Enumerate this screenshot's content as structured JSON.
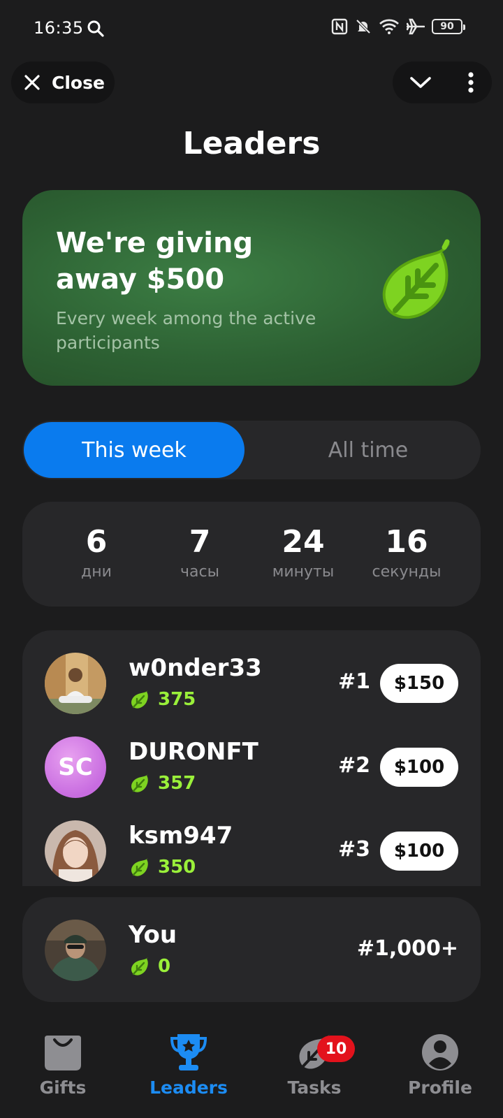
{
  "status_bar": {
    "time": "16:35",
    "battery": "90"
  },
  "topbar": {
    "close_label": "Close"
  },
  "page": {
    "title": "Leaders"
  },
  "banner": {
    "headline": "We're giving away $500",
    "subtitle": "Every week among the active participants"
  },
  "segmented": {
    "options": [
      "This week",
      "All time"
    ],
    "selected": "This week"
  },
  "countdown": [
    {
      "value": "6",
      "unit": "дни"
    },
    {
      "value": "7",
      "unit": "часы"
    },
    {
      "value": "24",
      "unit": "минуты"
    },
    {
      "value": "16",
      "unit": "секунды"
    }
  ],
  "leaderboard": [
    {
      "name": "w0nder33",
      "score": "375",
      "rank": "#1",
      "prize": "$150",
      "avatar": "photo"
    },
    {
      "name": "DURONFT",
      "score": "357",
      "rank": "#2",
      "prize": "$100",
      "avatar_initials": "SC"
    },
    {
      "name": "ksm947",
      "score": "350",
      "rank": "#3",
      "prize": "$100",
      "avatar": "photo"
    }
  ],
  "you": {
    "name": "You",
    "score": "0",
    "rank": "#1,000+"
  },
  "bottom_nav": {
    "items": [
      {
        "label": "Gifts",
        "icon": "bag-icon"
      },
      {
        "label": "Leaders",
        "icon": "trophy-icon"
      },
      {
        "label": "Tasks",
        "icon": "leaf-icon"
      },
      {
        "label": "Profile",
        "icon": "person-icon"
      }
    ],
    "active": "Leaders",
    "tasks_badge": "10"
  },
  "colors": {
    "background": "#1c1c1d",
    "card": "#272729",
    "accent_blue": "#0a7bee",
    "score_green": "#9af03a",
    "banner_green": "#2d6133",
    "badge_red": "#e3121c"
  }
}
